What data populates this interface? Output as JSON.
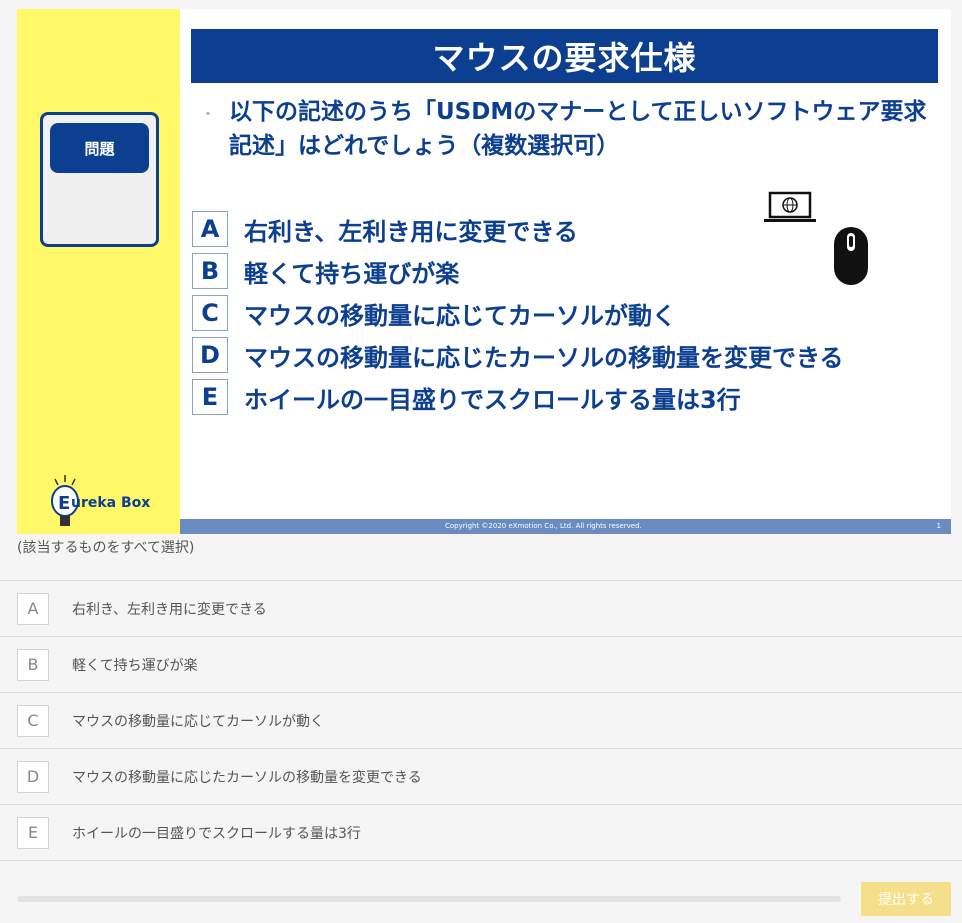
{
  "slide": {
    "side_card_title": "問題",
    "logo_text": "ureka Box",
    "logo_letter": "E",
    "title": "マウスの要求仕様",
    "bullet": "・",
    "question": "以下の記述のうち「USDMのマナーとして正しいソフトウェア要求記述」はどれでしょう（複数選択可）",
    "options": [
      {
        "letter": "A",
        "text": "右利き、左利き用に変更できる"
      },
      {
        "letter": "B",
        "text": "軽くて持ち運びが楽"
      },
      {
        "letter": "C",
        "text": "マウスの移動量に応じてカーソルが動く"
      },
      {
        "letter": "D",
        "text": "マウスの移動量に応じたカーソルの移動量を変更できる"
      },
      {
        "letter": "E",
        "text": "ホイールの一目盛りでスクロールする量は3行"
      }
    ],
    "footer_copyright": "Copyright ©2020 eXmotion Co., Ltd. All rights reserved.",
    "footer_page": "1",
    "icons": [
      "laptop-icon",
      "mouse-icon",
      "lightbulb-icon"
    ]
  },
  "instruction": "(該当するものをすべて選択)",
  "choices": [
    {
      "letter": "A",
      "text": "右利き、左利き用に変更できる"
    },
    {
      "letter": "B",
      "text": "軽くて持ち運びが楽"
    },
    {
      "letter": "C",
      "text": "マウスの移動量に応じてカーソルが動く"
    },
    {
      "letter": "D",
      "text": "マウスの移動量に応じたカーソルの移動量を変更できる"
    },
    {
      "letter": "E",
      "text": "ホイールの一目盛りでスクロールする量は3行"
    }
  ],
  "submit_label": "提出する",
  "colors": {
    "slide_blue": "#0c3f8f",
    "slide_yellow": "#fff96a",
    "submit_disabled": "#f5df8a"
  }
}
